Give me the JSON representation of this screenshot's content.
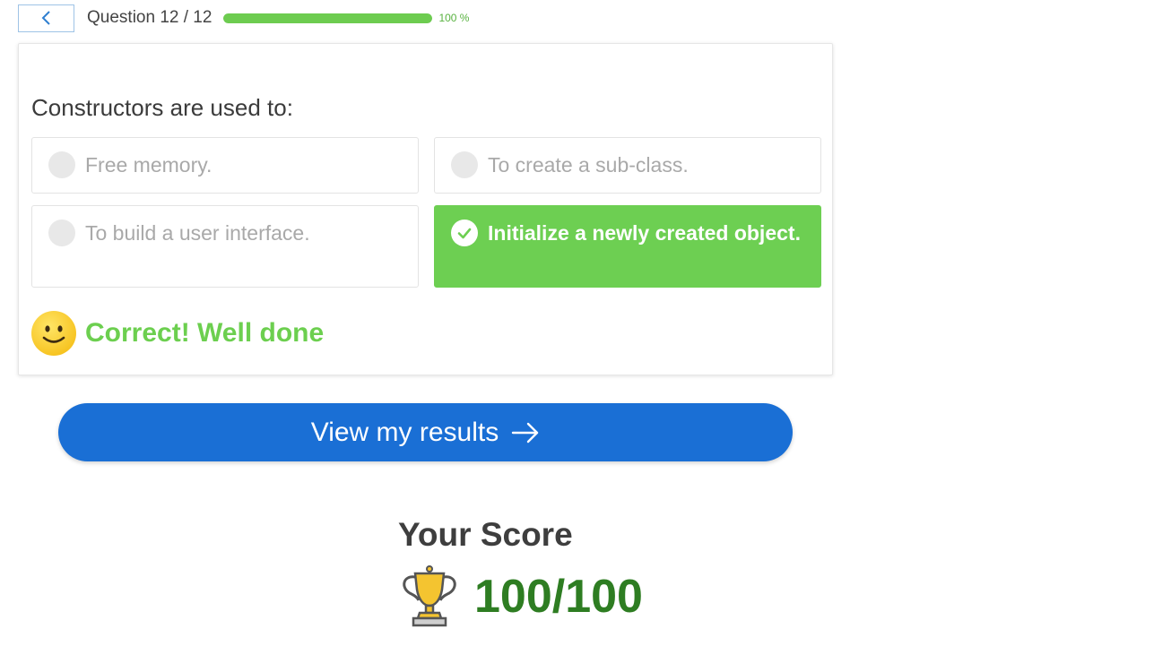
{
  "header": {
    "back_icon": "chevron-left-icon",
    "question_counter": "Question 12 / 12",
    "progress_percent": 100,
    "progress_text": "100 %",
    "progress_color": "#6dcc50"
  },
  "question": {
    "text": "Constructors are used to:",
    "options": [
      {
        "label": "Free memory.",
        "selected": false
      },
      {
        "label": "To create a sub-class.",
        "selected": false
      },
      {
        "label": "To build a user interface.",
        "selected": false
      },
      {
        "label": "Initialize a newly created object.",
        "selected": true,
        "correct": true
      }
    ],
    "correct_color": "#6dcf52"
  },
  "feedback": {
    "icon": "smiley-face-icon",
    "text": "Correct! Well done",
    "color": "#6ccf4f"
  },
  "results_button": {
    "label": "View my results",
    "icon": "arrow-right-icon",
    "color": "#1a6fd5"
  },
  "score": {
    "title": "Your Score",
    "icon": "trophy-icon",
    "value": "100/100",
    "color": "#2e7d22"
  }
}
